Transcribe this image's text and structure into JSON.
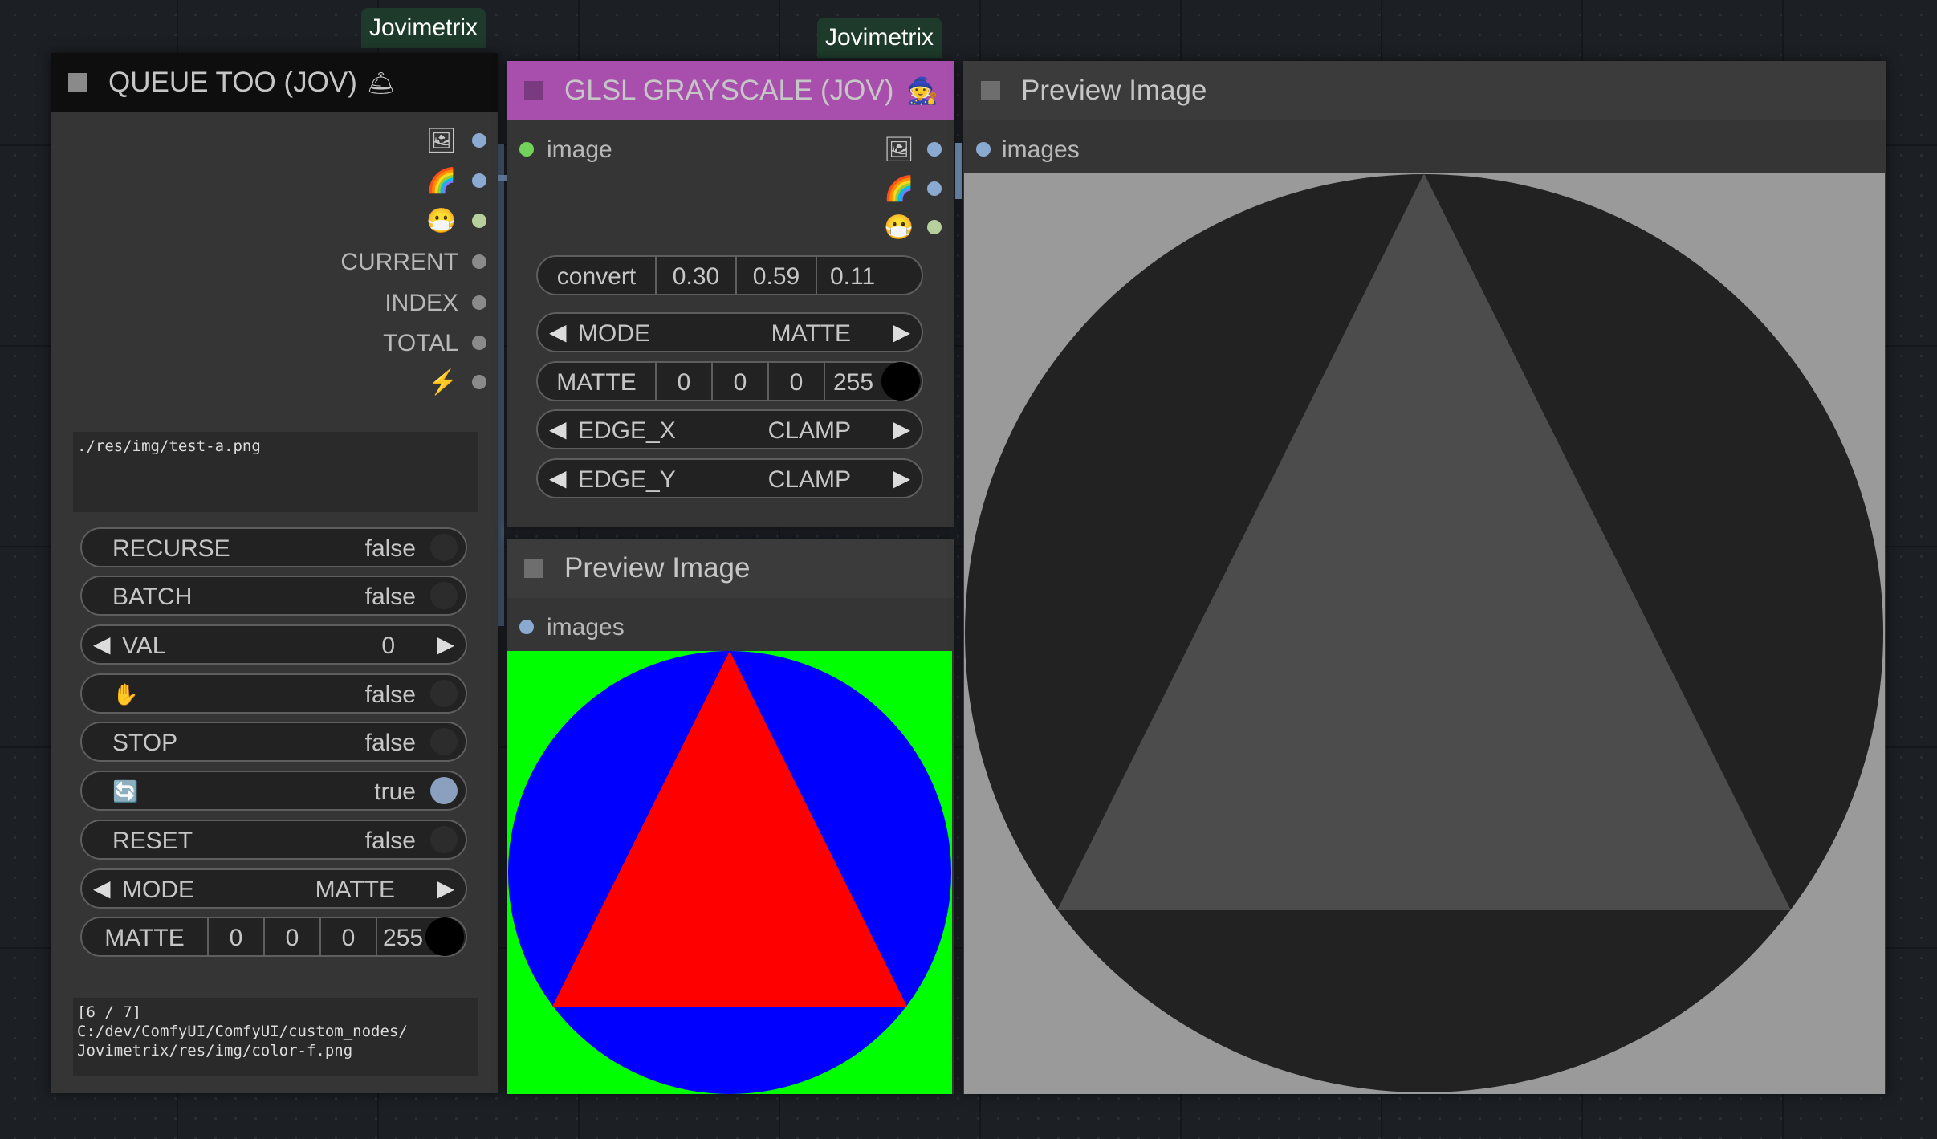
{
  "groups": [
    "Jovimetrix",
    "Jovimetrix"
  ],
  "queue_node": {
    "title": "QUEUE TOO (JOV)",
    "title_icon": "🛎",
    "outputs": [
      {
        "icon": "🖼",
        "name": "image-output-icon"
      },
      {
        "icon": "🌈",
        "name": "rainbow-output-icon"
      },
      {
        "icon": "😷",
        "name": "mask-output-icon"
      }
    ],
    "output_labels": [
      "CURRENT",
      "INDEX",
      "TOTAL"
    ],
    "trigger_icon": "⚡",
    "path_text": "./res/img/test-a.png",
    "recurse": {
      "label": "RECURSE",
      "value": "false"
    },
    "batch": {
      "label": "BATCH",
      "value": "false"
    },
    "val": {
      "label": "VAL",
      "value": "0"
    },
    "hold": {
      "icon": "✋",
      "value": "false"
    },
    "stop": {
      "label": "STOP",
      "value": "false"
    },
    "loop": {
      "icon": "🔄",
      "value": "true"
    },
    "reset": {
      "label": "RESET",
      "value": "false"
    },
    "mode": {
      "label": "MODE",
      "value": "MATTE"
    },
    "matte": {
      "label": "MATTE",
      "r": "0",
      "g": "0",
      "b": "0",
      "a": "255"
    },
    "status_text": "[6 / 7]\nC:/dev/ComfyUI/ComfyUI/custom_nodes/\nJovimetrix/res/img/color-f.png"
  },
  "glsl_node": {
    "title": "GLSL GRAYSCALE (JOV)",
    "title_icon": "🧙",
    "input_label": "image",
    "convert": {
      "label": "convert",
      "r": "0.30",
      "g": "0.59",
      "b": "0.11"
    },
    "mode": {
      "label": "MODE",
      "value": "MATTE"
    },
    "matte": {
      "label": "MATTE",
      "r": "0",
      "g": "0",
      "b": "0",
      "a": "255"
    },
    "edge_x": {
      "label": "EDGE_X",
      "value": "CLAMP"
    },
    "edge_y": {
      "label": "EDGE_Y",
      "value": "CLAMP"
    }
  },
  "preview_small": {
    "title": "Preview Image",
    "input_label": "images"
  },
  "preview_large": {
    "title": "Preview Image",
    "input_label": "images"
  },
  "colors": {
    "glsl_title": "#a84fae",
    "green": "#00ff00",
    "blue": "#0000ff",
    "red": "#ff0000",
    "gray_bg": "#9a9a9a",
    "gray_circle": "#222222",
    "gray_triangle": "#4c4c4c"
  }
}
